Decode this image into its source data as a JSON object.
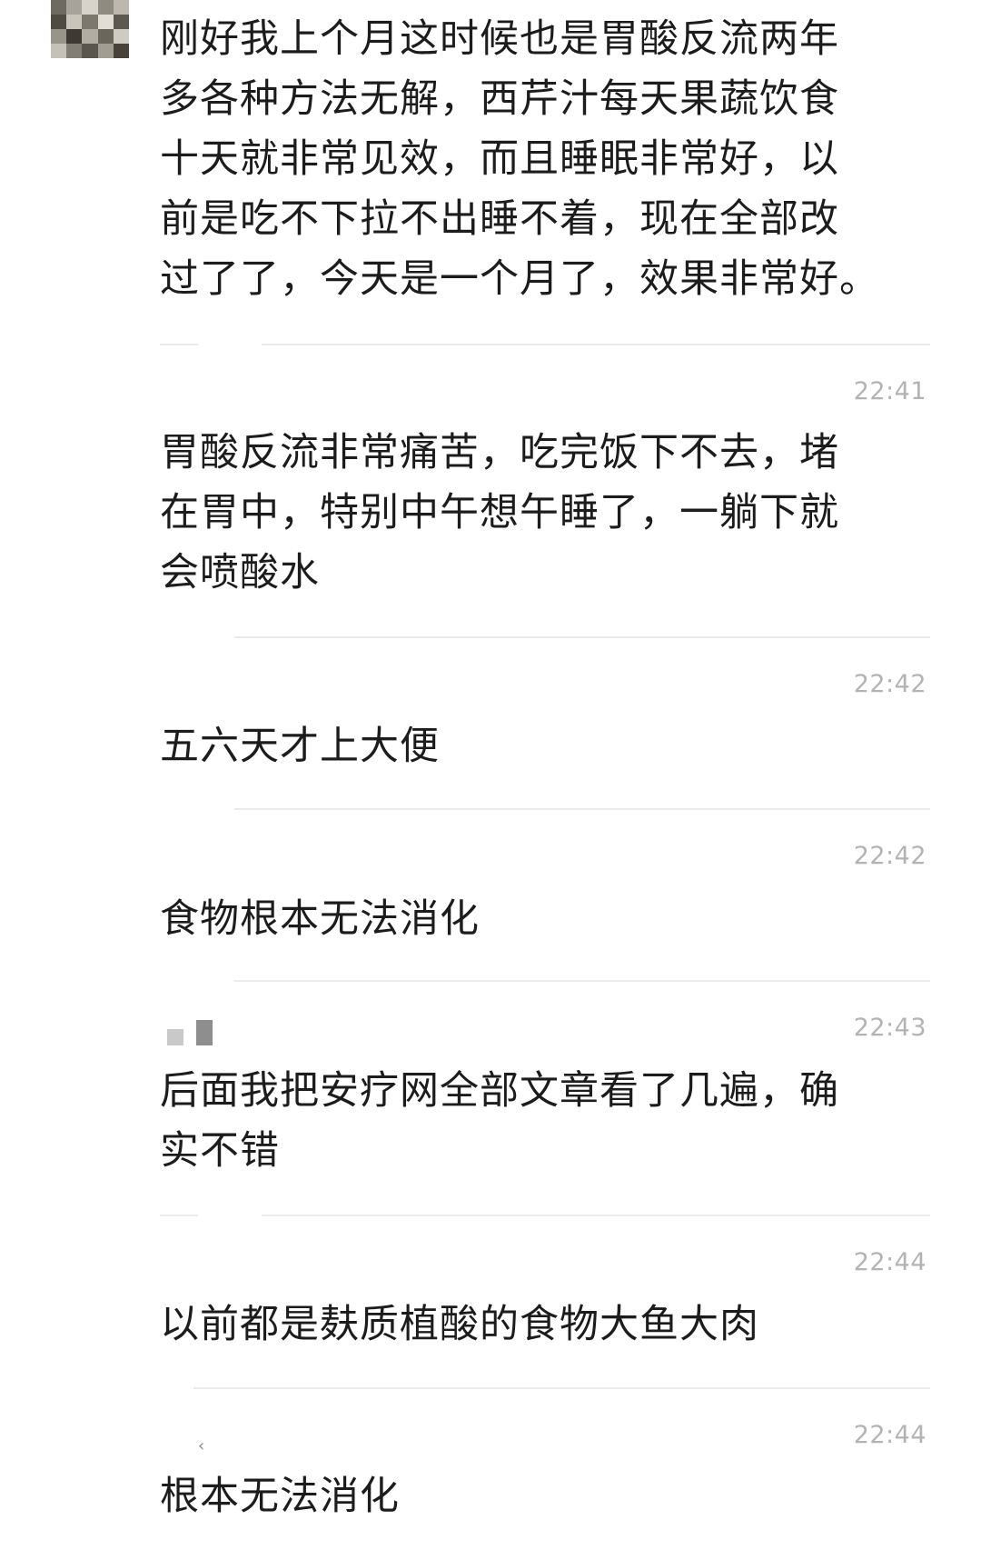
{
  "messages": [
    {
      "text": "刚好我上个月这时候也是胃酸反流两年\n多各种方法无解，西芹汁每天果蔬饮食\n十天就非常见效，而且睡眠非常好，以\n前是吃不下拉不出睡不着，现在全部改\n过了了，今天是一个月了，效果非常好。"
    },
    {
      "time": "22:41",
      "text": "胃酸反流非常痛苦，吃完饭下不去，堵\n在胃中，特别中午想午睡了，一躺下就\n会喷酸水"
    },
    {
      "time": "22:42",
      "text": "五六天才上大便"
    },
    {
      "time": "22:42",
      "text": "食物根本无法消化"
    },
    {
      "time": "22:43",
      "text": "后面我把安疗网全部文章看了几遍，确\n实不错"
    },
    {
      "time": "22:44",
      "text": "以前都是麸质植酸的食物大鱼大肉"
    },
    {
      "time": "22:44",
      "text": "根本无法消化"
    }
  ],
  "colors": {
    "text": "#1c1c1c",
    "timestamp": "#b3b3b3",
    "divider": "#eaeaea"
  }
}
